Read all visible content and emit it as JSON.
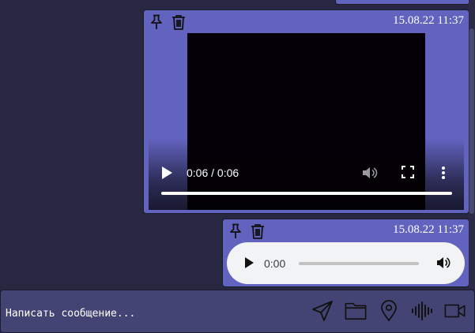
{
  "messages": [
    {
      "type": "video",
      "time": "15.08.22 11:37",
      "player": {
        "time_display": "0:06 / 0:06",
        "progress": 1.0
      }
    },
    {
      "type": "audio",
      "time": "15.08.22 11:37",
      "player": {
        "time_display": "0:00",
        "progress": 0.0
      }
    }
  ],
  "composer": {
    "placeholder": "Написать сообщение...",
    "value": "",
    "tools": [
      "send-icon",
      "folder-icon",
      "location-pin-icon",
      "voice-record-icon",
      "video-camera-icon"
    ]
  },
  "colors": {
    "background": "#272742",
    "message_bubble": "#6262bf",
    "composer": "#444474",
    "text": "#ffffff"
  },
  "icons": {
    "pin": "pin-icon",
    "delete": "trash-icon"
  }
}
